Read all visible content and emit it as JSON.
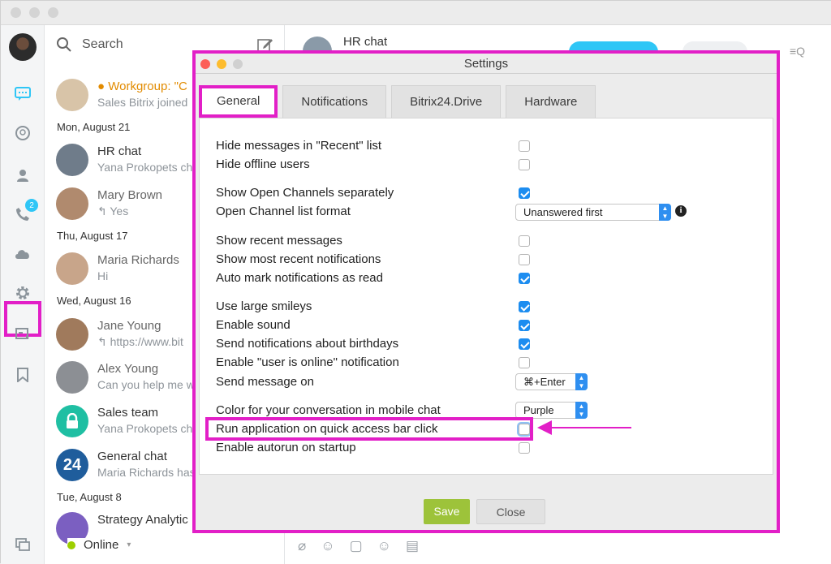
{
  "colors": {
    "highlight": "#e21fc7",
    "accent": "#1d8df0",
    "save": "#9dc33a",
    "online": "#9dcf00",
    "warning": "#e28b00"
  },
  "sidebar": {
    "search_label": "Search",
    "badge_count": "2",
    "icons": [
      "chat-icon",
      "search-messages-icon",
      "contacts-icon",
      "phone-icon",
      "cloud-icon",
      "gear-icon",
      "notifications-icon",
      "bookmark-icon"
    ],
    "status": "Online"
  },
  "chat_list": {
    "items": [
      {
        "name": "Workgroup: \"C",
        "sub": "Sales Bitrix joined"
      },
      {
        "date": "Mon, August 21"
      },
      {
        "name": "HR chat",
        "sub": "Yana Prokopets ch"
      },
      {
        "name": "Mary Brown",
        "sub": "↰ Yes"
      },
      {
        "date": "Thu, August 17"
      },
      {
        "name": "Maria Richards",
        "sub": "Hi"
      },
      {
        "date": "Wed, August 16"
      },
      {
        "name": "Jane Young",
        "sub": "↰ https://www.bit"
      },
      {
        "name": "Alex Young",
        "sub": "Can you help me w"
      },
      {
        "name": "Sales team",
        "sub": "Yana Prokopets ch"
      },
      {
        "name": "General chat",
        "sub": "Maria Richards has"
      },
      {
        "date": "Tue, August 8"
      },
      {
        "name": "Strategy Analytic",
        "sub": ""
      }
    ],
    "general_chat_avatar": "24"
  },
  "chat_header": {
    "title": "HR chat"
  },
  "settings": {
    "title": "Settings",
    "tabs": [
      "General",
      "Notifications",
      "Bitrix24.Drive",
      "Hardware"
    ],
    "active_tab": "General",
    "options": [
      {
        "label": "Hide messages in \"Recent\" list",
        "checked": false
      },
      {
        "label": "Hide offline users",
        "checked": false
      },
      {
        "label": "Show Open Channels separately",
        "checked": true
      },
      {
        "label": "Open Channel list format",
        "select": "Unanswered first"
      },
      {
        "label": "Show recent messages",
        "checked": false
      },
      {
        "label": "Show most recent notifications",
        "checked": false
      },
      {
        "label": "Auto mark notifications as read",
        "checked": true
      },
      {
        "label": "Use large smileys",
        "checked": true
      },
      {
        "label": "Enable sound",
        "checked": true
      },
      {
        "label": "Send notifications about birthdays",
        "checked": true
      },
      {
        "label": "Enable \"user is online\" notification",
        "checked": false
      },
      {
        "label": "Send message on",
        "select": "⌘+Enter"
      },
      {
        "label": "Color for your conversation in mobile chat",
        "select": "Purple"
      },
      {
        "label": "Run application on quick access bar click",
        "checked": false
      },
      {
        "label": "Enable autorun on startup",
        "checked": false
      }
    ],
    "info_glyph": "i",
    "save_label": "Save",
    "close_label": "Close"
  }
}
